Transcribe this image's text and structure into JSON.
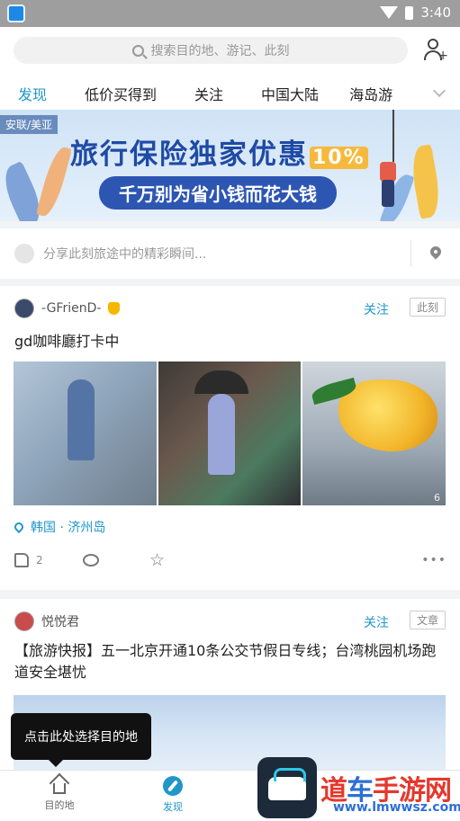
{
  "status": {
    "time": "3:40"
  },
  "search": {
    "placeholder": "搜索目的地、游记、此刻"
  },
  "tabs": [
    {
      "label": "发现",
      "active": true
    },
    {
      "label": "低价买得到",
      "active": false
    },
    {
      "label": "关注",
      "active": false
    },
    {
      "label": "中国大陆",
      "active": false
    },
    {
      "label": "海岛游",
      "active": false
    }
  ],
  "banner": {
    "tag": "安联/美亚",
    "title": "旅行保险独家优惠",
    "badge": "10%",
    "subtitle": "千万别为省小钱而花大钱"
  },
  "share": {
    "placeholder": "分享此刻旅途中的精彩瞬间..."
  },
  "feed": [
    {
      "author": "-GFrienD-",
      "follow_label": "关注",
      "type": "此刻",
      "title": "gd咖啡廳打卡中",
      "photo_count": "6",
      "location": "韩国 · 济州岛",
      "likes": "2"
    },
    {
      "author": "悦悦君",
      "follow_label": "关注",
      "type": "文章",
      "title": "【旅游快报】五一北京开通10条公交节假日专线；台湾桃园机场跑道安全堪忧"
    }
  ],
  "tooltip": {
    "text": "点击此处选择目的地"
  },
  "bottom_nav": [
    {
      "label": "目的地",
      "icon": "home-icon"
    },
    {
      "label": "发现",
      "icon": "compass-icon",
      "active": true
    }
  ],
  "watermark": {
    "name_red1": "道",
    "name_blue": "车",
    "name_red2": "手游网",
    "url": "www.lmwwsz.com"
  },
  "colors": {
    "accent": "#2196c9",
    "banner_title": "#1f4aa5",
    "tooltip_bg": "#111111"
  }
}
